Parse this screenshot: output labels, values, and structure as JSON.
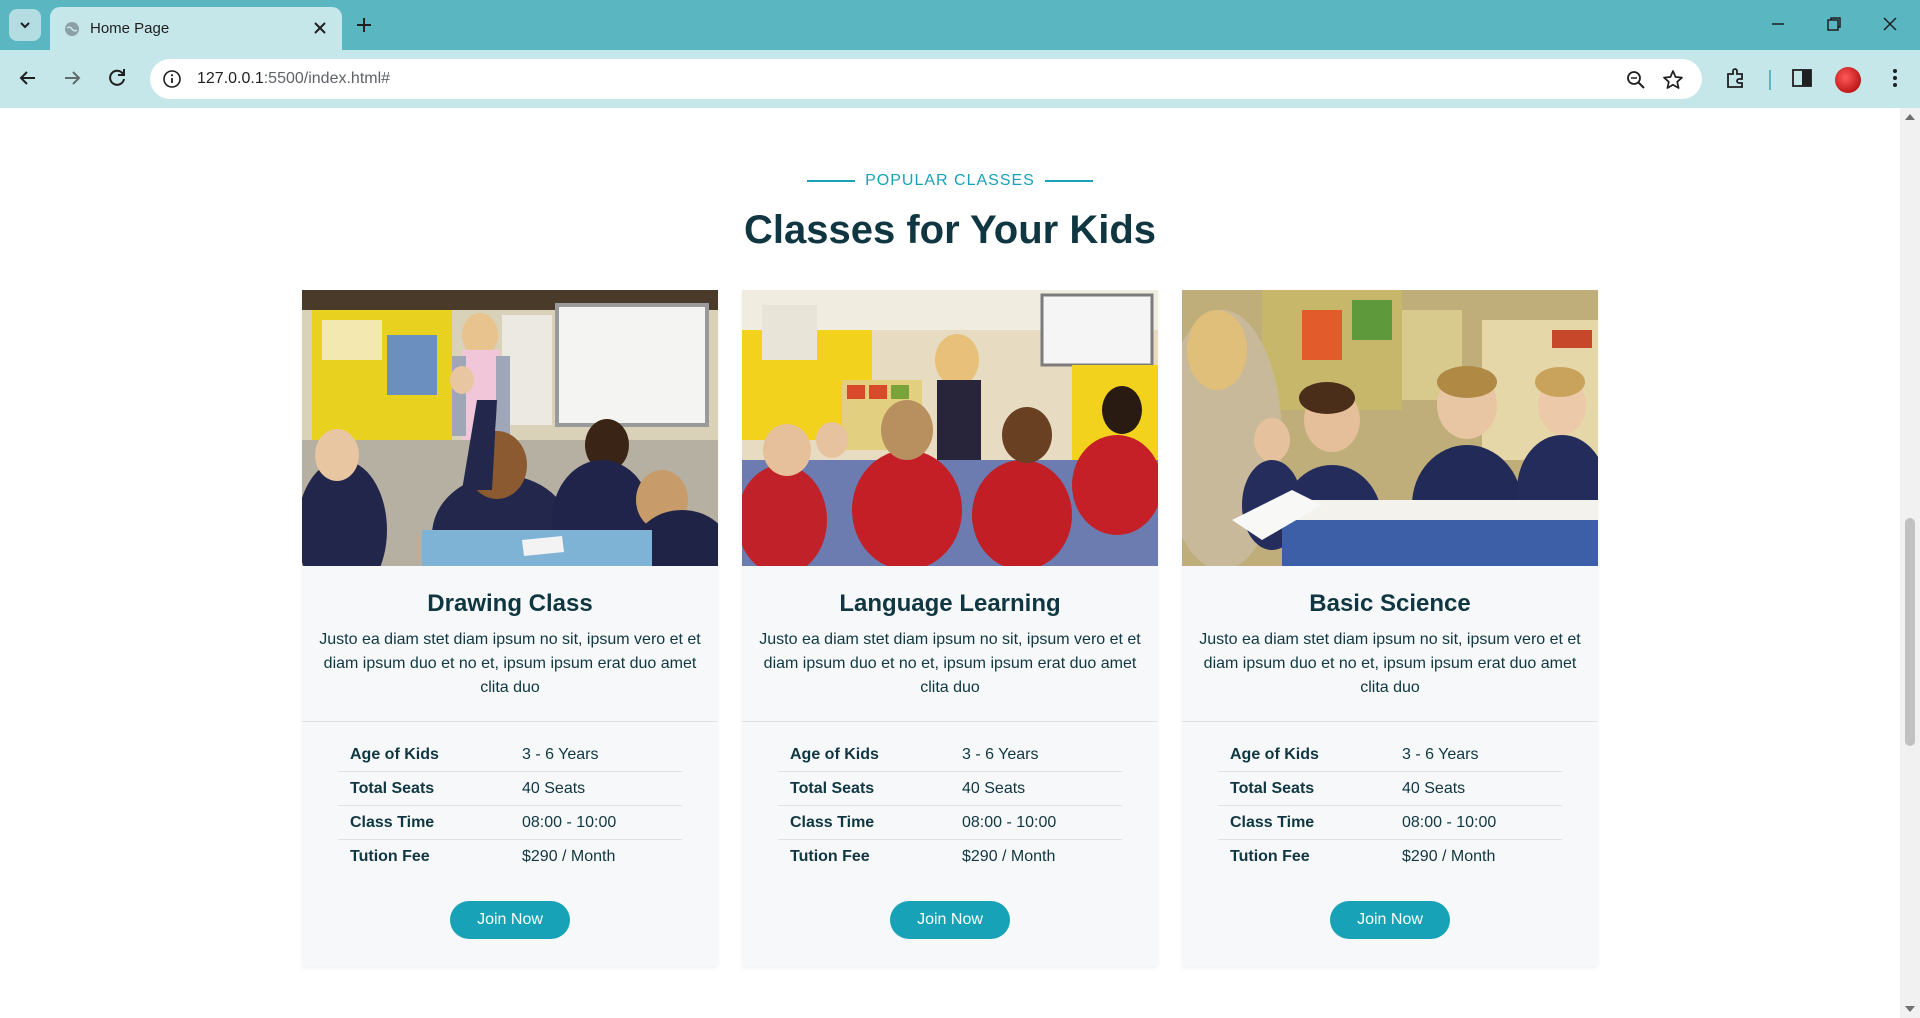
{
  "browser": {
    "tab_title": "Home Page",
    "url_host": "127.0.0.1",
    "url_path": ":5500/index.html#"
  },
  "section": {
    "tag": "POPULAR CLASSES",
    "title": "Classes for Your Kids"
  },
  "classes": [
    {
      "title": "Drawing Class",
      "description": "Justo ea diam stet diam ipsum no sit, ipsum vero et et diam ipsum duo et no et, ipsum ipsum erat duo amet clita duo",
      "rows": [
        {
          "label": "Age of Kids",
          "value": "3 - 6 Years"
        },
        {
          "label": "Total Seats",
          "value": "40 Seats"
        },
        {
          "label": "Class Time",
          "value": "08:00 - 10:00"
        },
        {
          "label": "Tution Fee",
          "value": "$290 / Month"
        }
      ],
      "button": "Join Now"
    },
    {
      "title": "Language Learning",
      "description": "Justo ea diam stet diam ipsum no sit, ipsum vero et et diam ipsum duo et no et, ipsum ipsum erat duo amet clita duo",
      "rows": [
        {
          "label": "Age of Kids",
          "value": "3 - 6 Years"
        },
        {
          "label": "Total Seats",
          "value": "40 Seats"
        },
        {
          "label": "Class Time",
          "value": "08:00 - 10:00"
        },
        {
          "label": "Tution Fee",
          "value": "$290 / Month"
        }
      ],
      "button": "Join Now"
    },
    {
      "title": "Basic Science",
      "description": "Justo ea diam stet diam ipsum no sit, ipsum vero et et diam ipsum duo et no et, ipsum ipsum erat duo amet clita duo",
      "rows": [
        {
          "label": "Age of Kids",
          "value": "3 - 6 Years"
        },
        {
          "label": "Total Seats",
          "value": "40 Seats"
        },
        {
          "label": "Class Time",
          "value": "08:00 - 10:00"
        },
        {
          "label": "Tution Fee",
          "value": "$290 / Month"
        }
      ],
      "button": "Join Now"
    }
  ],
  "colors": {
    "accent": "#17a2b8",
    "heading": "#103741",
    "chrome": "#5ab6c1",
    "chrome_light": "#c6e7ea",
    "card_bg": "#f6f8f9"
  }
}
